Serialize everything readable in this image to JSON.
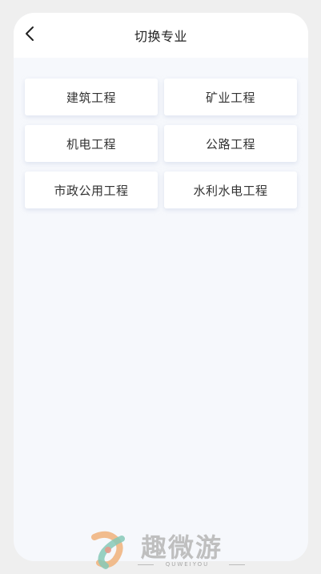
{
  "header": {
    "title": "切换专业",
    "back_icon": "chevron-left-icon"
  },
  "majors": [
    {
      "label": "建筑工程"
    },
    {
      "label": "矿业工程"
    },
    {
      "label": "机电工程"
    },
    {
      "label": "公路工程"
    },
    {
      "label": "市政公用工程"
    },
    {
      "label": "水利水电工程"
    }
  ],
  "watermark": {
    "text": "趣微游",
    "subtext": "QUWEIYOU",
    "logo": "quweiyou-logo"
  }
}
